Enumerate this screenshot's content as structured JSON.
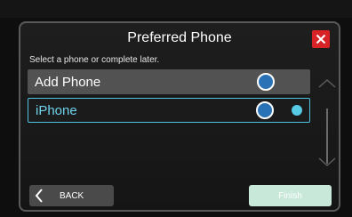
{
  "dialog": {
    "title": "Preferred Phone",
    "subtitle": "Select a phone or complete later.",
    "close_icon": "close-x-icon"
  },
  "list": {
    "items": [
      {
        "label": "Add Phone",
        "selected": false,
        "connected": false
      },
      {
        "label": "iPhone",
        "selected": true,
        "connected": true
      }
    ]
  },
  "footer": {
    "back_label": "BACK",
    "finish_label": "Finish",
    "finish_enabled": false
  },
  "colors": {
    "close": "#d92226",
    "highlight": "#4ec2e0",
    "radio": "#2a72b6",
    "finish_disabled": "#c8e8da"
  }
}
